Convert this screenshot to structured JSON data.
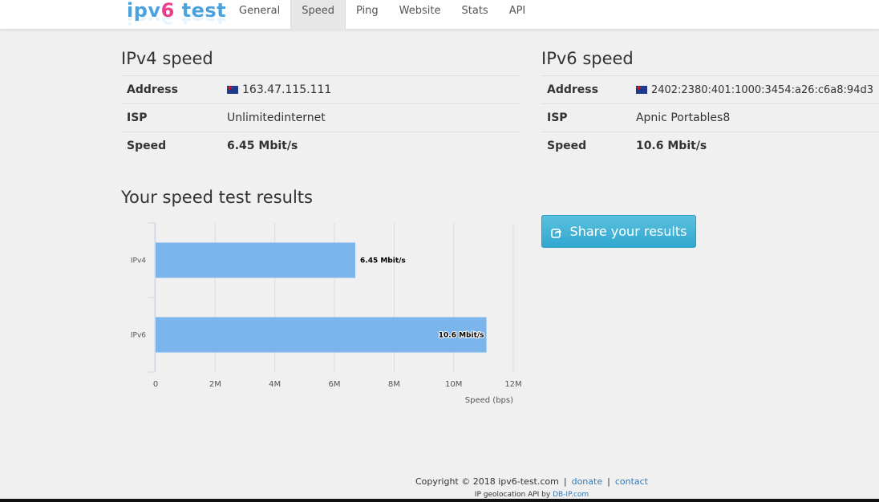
{
  "logo": {
    "part1": "ipv",
    "part2": "6",
    "part3": " test"
  },
  "nav": [
    {
      "label": "General",
      "active": false
    },
    {
      "label": "Speed",
      "active": true
    },
    {
      "label": "Ping",
      "active": false
    },
    {
      "label": "Website",
      "active": false
    },
    {
      "label": "Stats",
      "active": false
    },
    {
      "label": "API",
      "active": false
    }
  ],
  "ipv4": {
    "title": "IPv4 speed",
    "address_label": "Address",
    "address": "163.47.115.111",
    "isp_label": "ISP",
    "isp": "Unlimitedinternet",
    "speed_label": "Speed",
    "speed": "6.45 Mbit/s"
  },
  "ipv6": {
    "title": "IPv6 speed",
    "address_label": "Address",
    "address": "2402:2380:401:1000:3454:a26:c6a8:94d3",
    "isp_label": "ISP",
    "isp": "Apnic Portables8",
    "speed_label": "Speed",
    "speed": "10.6 Mbit/s"
  },
  "results_title": "Your speed test results",
  "share_button": "Share your results",
  "colors": {
    "bar": "#7cb5ec",
    "share": "#5bc0de",
    "accent_pink": "#e83e8c"
  },
  "chart_data": {
    "type": "bar",
    "orientation": "horizontal",
    "categories": [
      "IPv4",
      "IPv6"
    ],
    "values": [
      6700000,
      11100000
    ],
    "data_labels": [
      "6.45 Mbit/s",
      "10.6 Mbit/s"
    ],
    "xlim": [
      0,
      12000000
    ],
    "xticks": [
      0,
      2000000,
      4000000,
      6000000,
      8000000,
      10000000,
      12000000
    ],
    "xtick_labels": [
      "0",
      "2M",
      "4M",
      "6M",
      "8M",
      "10M",
      "12M"
    ],
    "xlabel": "Speed (bps)",
    "grid": true
  },
  "footer": {
    "copyright": "Copyright © 2018 ipv6-test.com",
    "donate": "donate",
    "contact": "contact",
    "geo_prefix": "IP geolocation API by ",
    "geo_link": "DB-IP.com"
  }
}
